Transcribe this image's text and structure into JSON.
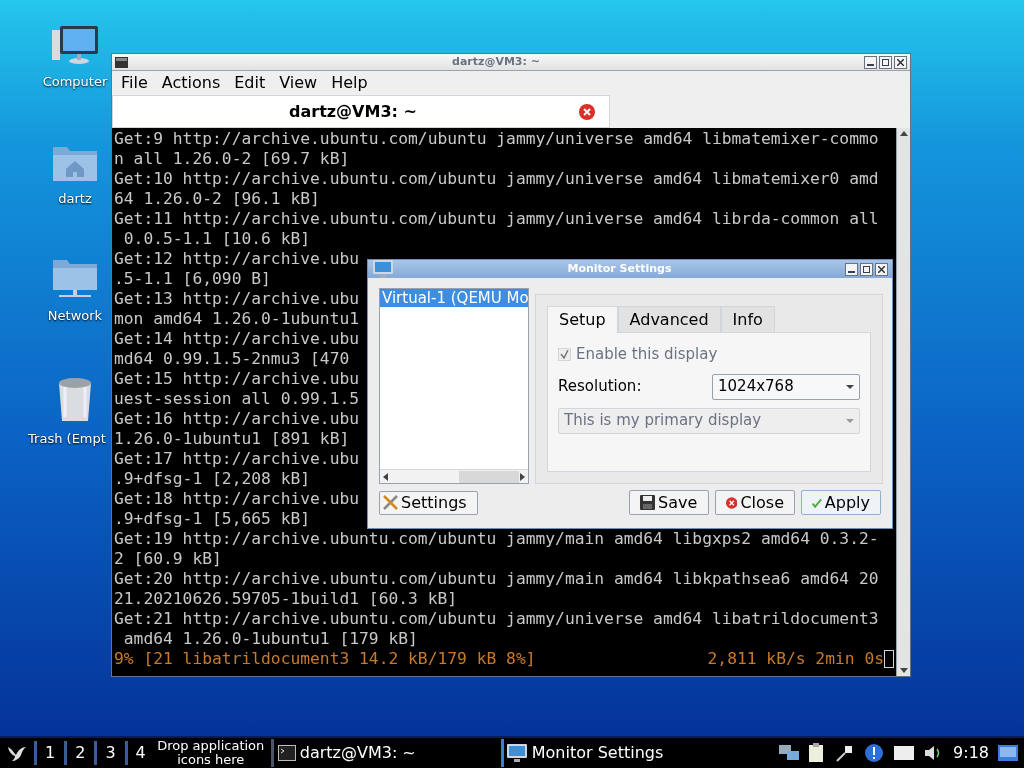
{
  "desktop_icons": [
    {
      "kind": "computer",
      "label": "Computer"
    },
    {
      "kind": "home",
      "label": "dartz"
    },
    {
      "kind": "network",
      "label": "Network"
    },
    {
      "kind": "trash",
      "label": "Trash (Empt"
    }
  ],
  "terminal": {
    "title": "dartz@VM3: ~",
    "menu": [
      "File",
      "Actions",
      "Edit",
      "View",
      "Help"
    ],
    "tab": {
      "label": "dartz@VM3: ~"
    },
    "lines": [
      "Get:9 http://archive.ubuntu.com/ubuntu jammy/universe amd64 libmatemixer-commo",
      "n all 1.26.0-2 [69.7 kB]",
      "Get:10 http://archive.ubuntu.com/ubuntu jammy/universe amd64 libmatemixer0 amd",
      "64 1.26.0-2 [96.1 kB]",
      "Get:11 http://archive.ubuntu.com/ubuntu jammy/universe amd64 librda-common all",
      " 0.0.5-1.1 [10.6 kB]",
      "Get:12 http://archive.ubu",
      ".5-1.1 [6,090 B]",
      "Get:13 http://archive.ubu",
      "mon amd64 1.26.0-1ubuntu1",
      "Get:14 http://archive.ubu",
      "md64 0.99.1.5-2nmu3 [470",
      "Get:15 http://archive.ubu",
      "uest-session all 0.99.1.5",
      "Get:16 http://archive.ubu",
      "1.26.0-1ubuntu1 [891 kB]",
      "Get:17 http://archive.ubu",
      ".9+dfsg-1 [2,208 kB]",
      "Get:18 http://archive.ubu",
      ".9+dfsg-1 [5,665 kB]",
      "Get:19 http://archive.ubuntu.com/ubuntu jammy/main amd64 libgxps2 amd64 0.3.2-",
      "2 [60.9 kB]",
      "Get:20 http://archive.ubuntu.com/ubuntu jammy/main amd64 libkpathsea6 amd64 20",
      "21.20210626.59705-1build1 [60.3 kB]",
      "Get:21 http://archive.ubuntu.com/ubuntu jammy/universe amd64 libatrildocument3",
      " amd64 1.26.0-1ubuntu1 [179 kB]"
    ],
    "progress": {
      "left": "9% [21 libatrildocument3 14.2 kB/179 kB 8%]",
      "right": "2,811 kB/s 2min 0s"
    }
  },
  "dialog": {
    "title": "Monitor Settings",
    "monitors": [
      {
        "label": "Virtual-1 (QEMU Mo",
        "selected": true
      }
    ],
    "tabs": [
      {
        "label": "Setup",
        "selected": true
      },
      {
        "label": "Advanced",
        "selected": false
      },
      {
        "label": "Info",
        "selected": false
      }
    ],
    "enable": {
      "label": "Enable this display",
      "checked": true,
      "disabled": true
    },
    "resolution": {
      "label": "Resolution:",
      "value": "1024x768"
    },
    "primary": {
      "value": "This is my primary display",
      "disabled": true
    },
    "settings_button": "Settings",
    "buttons": [
      {
        "kind": "save",
        "label": "Save"
      },
      {
        "kind": "close",
        "label": "Close"
      },
      {
        "kind": "apply",
        "label": "Apply"
      }
    ]
  },
  "taskbar": {
    "workspaces": [
      "1",
      "2",
      "3",
      "4"
    ],
    "launcher_hint": "Drop application icons here",
    "tasks": [
      {
        "kind": "terminal",
        "label": "dartz@VM3: ~"
      },
      {
        "kind": "monitor",
        "label": "Monitor Settings"
      }
    ],
    "clock": "9:18"
  }
}
